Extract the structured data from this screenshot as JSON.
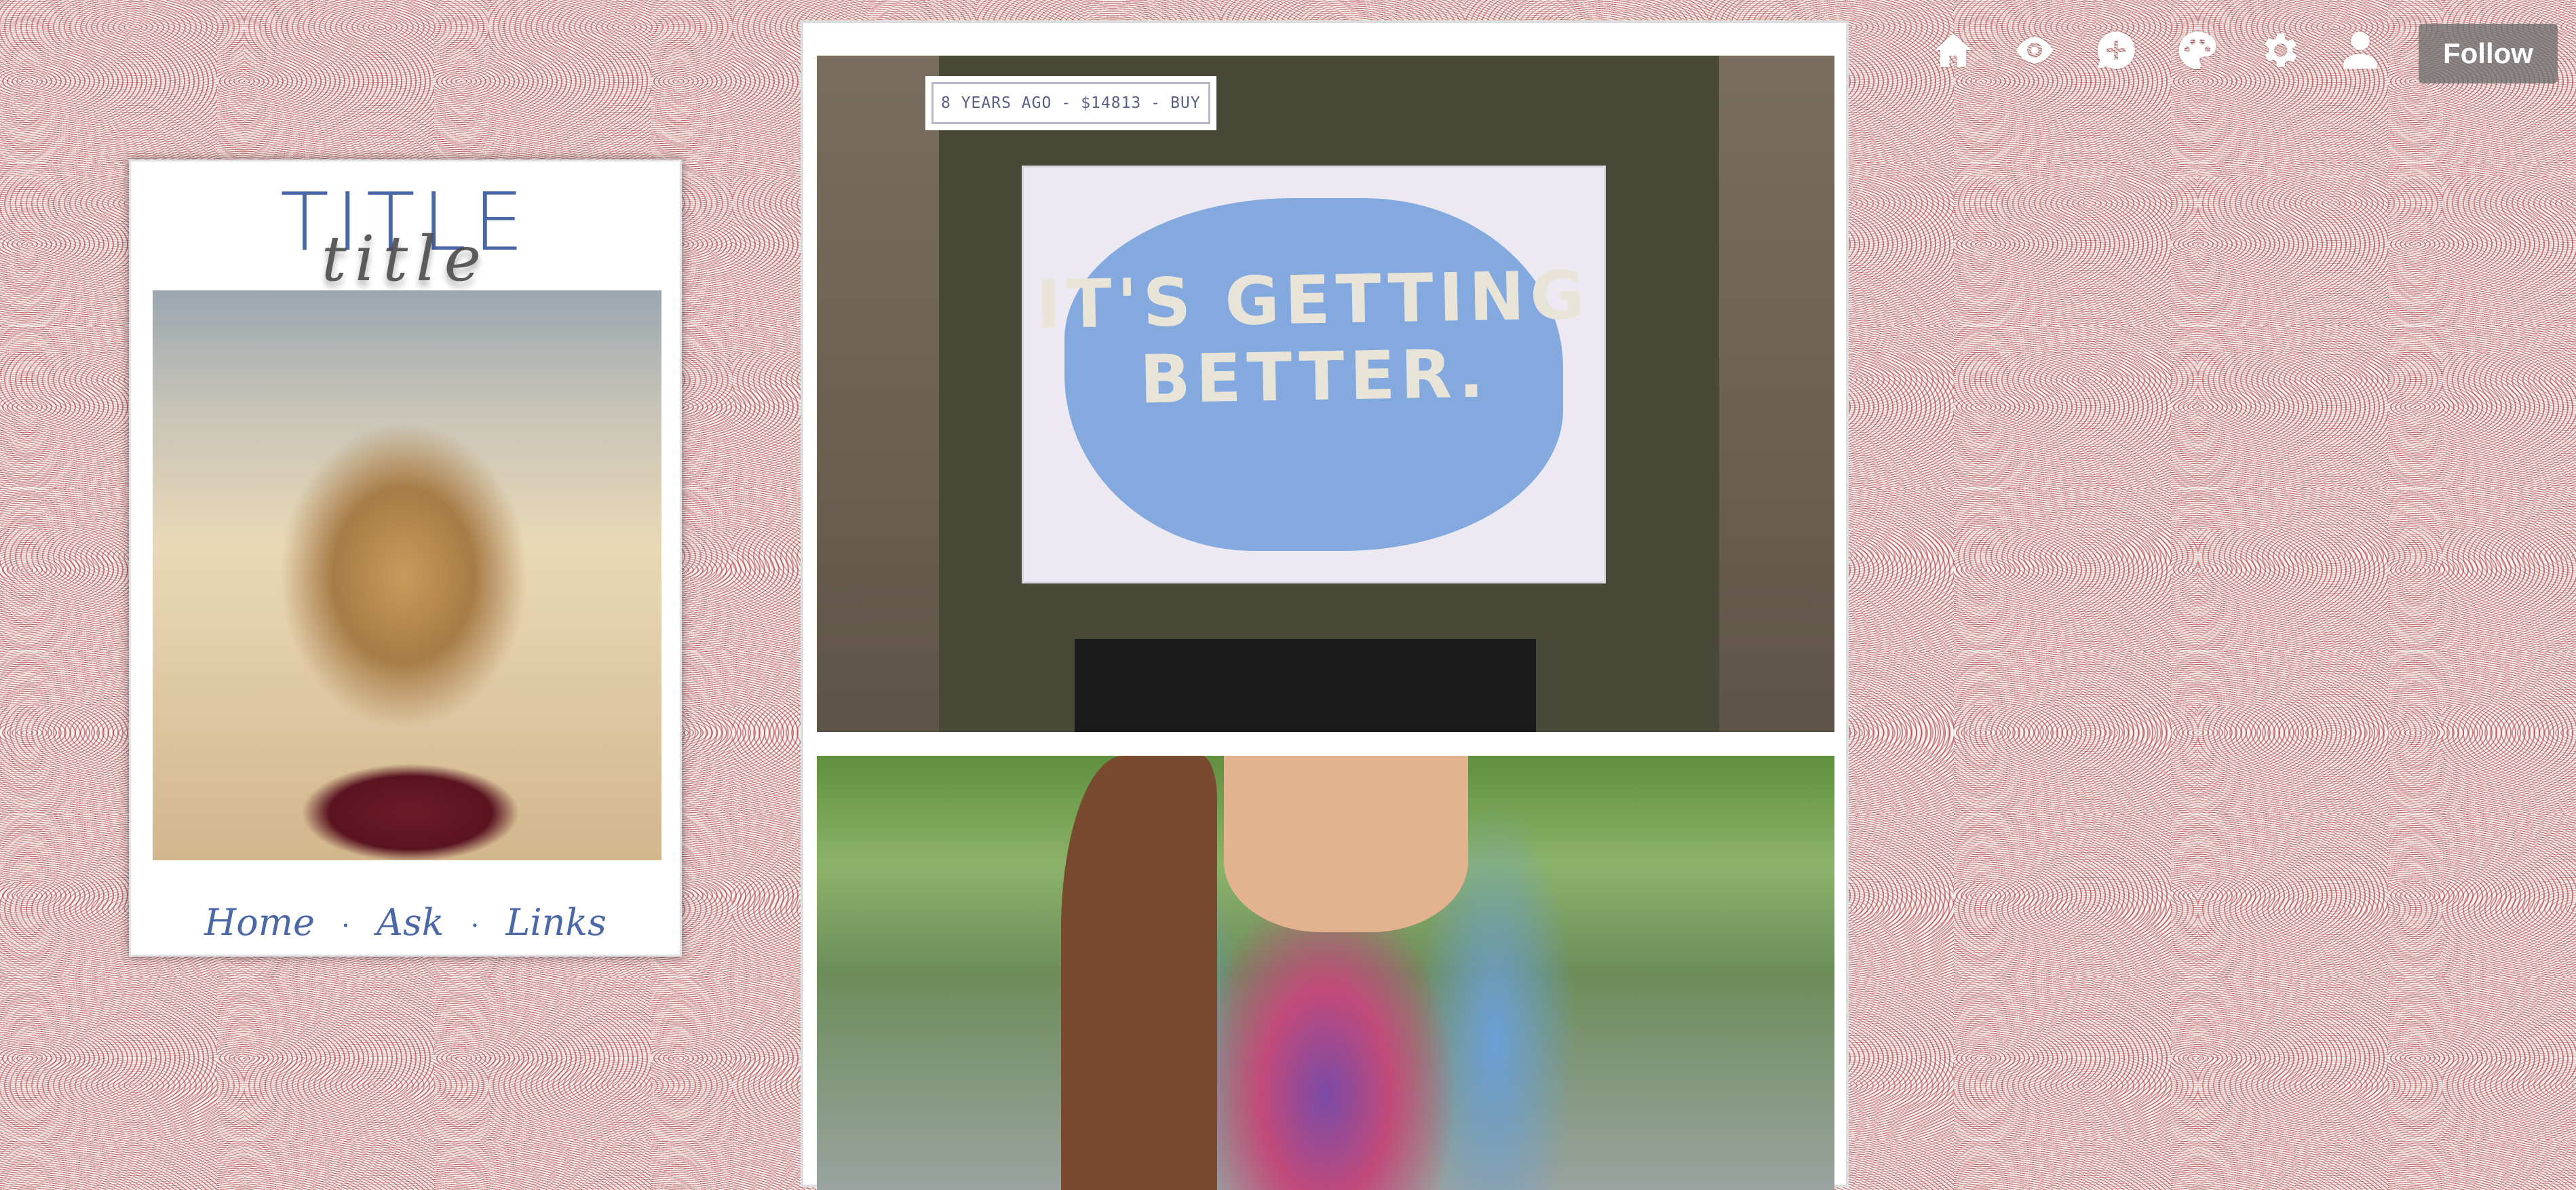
{
  "sidebar": {
    "title": "TITLE",
    "title_script": "title",
    "nav": {
      "home": "Home",
      "ask": "Ask",
      "links": "Links",
      "separator": "·"
    }
  },
  "posts": [
    {
      "meta": {
        "time": "8 YEARS AGO",
        "price": "$14813",
        "buy": "BUY",
        "separator": "-"
      },
      "sign_text": "IT'S GETTING BETTER."
    }
  ],
  "toolbar": {
    "icons": [
      "home-icon",
      "eye-icon",
      "chat-plus-icon",
      "palette-icon",
      "gear-icon",
      "user-icon"
    ],
    "follow_label": "Follow"
  },
  "colors": {
    "accent": "#4a67a8",
    "pattern": "#a63a3a",
    "meta_text": "#5a5f85"
  }
}
